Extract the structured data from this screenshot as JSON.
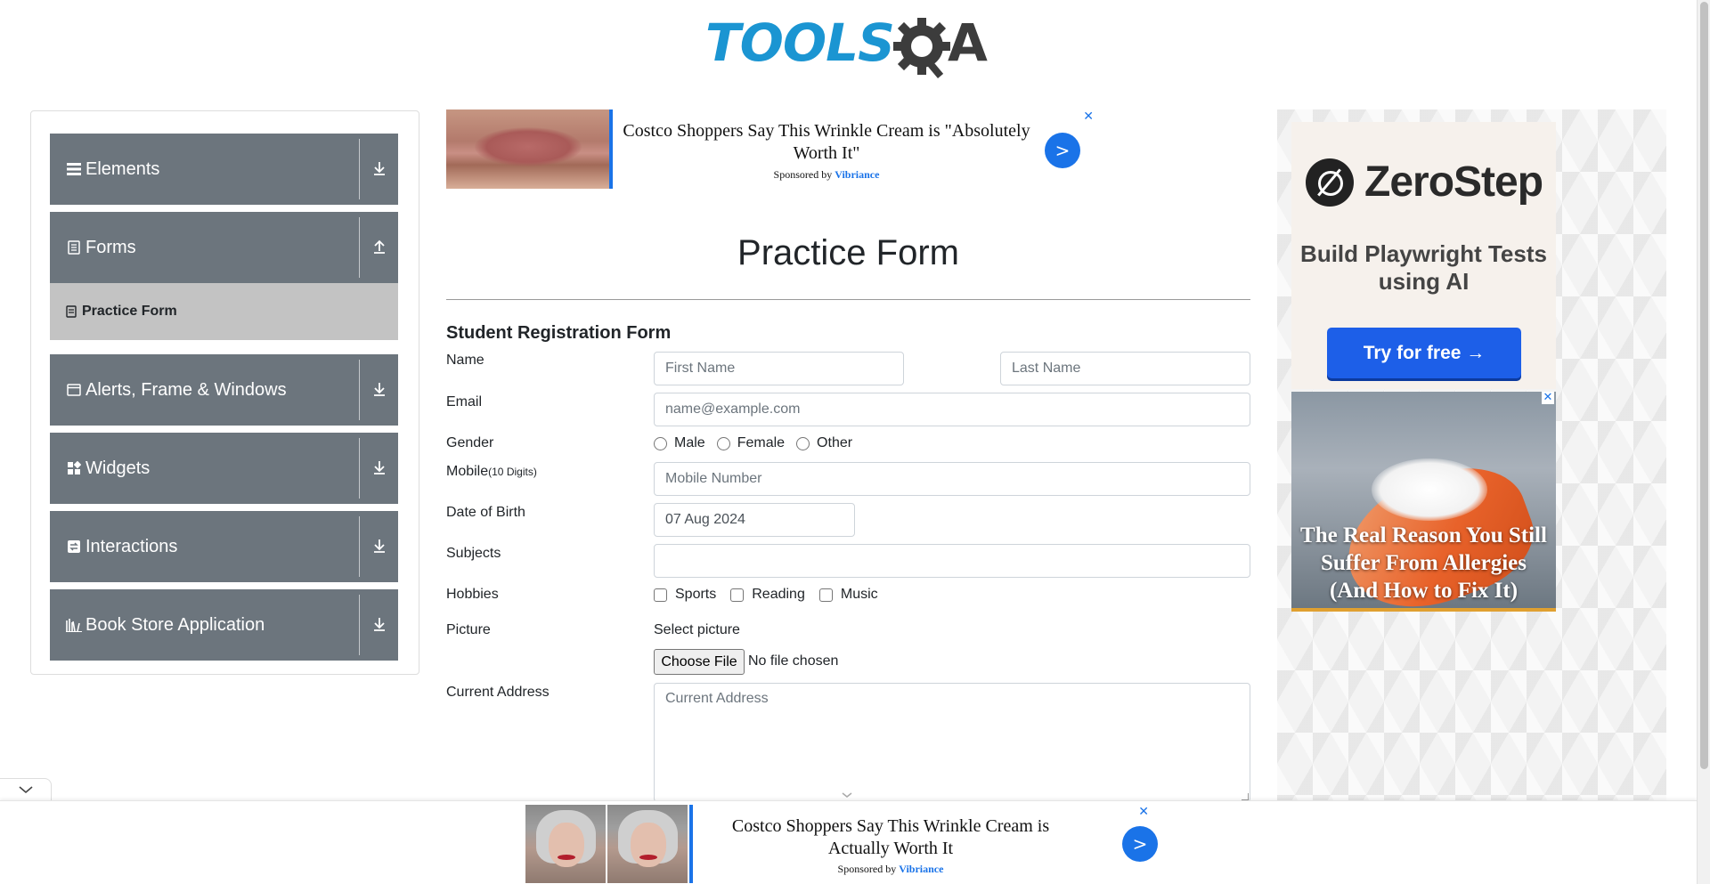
{
  "brand": {
    "logo_text": "TOOLS",
    "logo_suffix": "A"
  },
  "sidebar": {
    "groups": [
      {
        "label": "Elements",
        "icon": "menu-icon",
        "arrow": "download-arrow-icon"
      },
      {
        "label": "Forms",
        "icon": "document-icon",
        "arrow": "upload-arrow-icon"
      },
      {
        "label": "Alerts, Frame & Windows",
        "icon": "window-icon",
        "arrow": "download-arrow-icon"
      },
      {
        "label": "Widgets",
        "icon": "widgets-icon",
        "arrow": "download-arrow-icon"
      },
      {
        "label": "Interactions",
        "icon": "interactions-icon",
        "arrow": "download-arrow-icon"
      },
      {
        "label": "Book Store Application",
        "icon": "library-icon",
        "arrow": "download-arrow-icon"
      }
    ],
    "active_item": "Practice Form"
  },
  "top_ad": {
    "headline": "Costco Shoppers Say This Wrinkle Cream is \"Absolutely Worth It\"",
    "sponsored_prefix": "Sponsored by",
    "sponsor": "Vibriance",
    "go": ">",
    "close": "✕"
  },
  "form": {
    "page_title": "Practice Form",
    "form_title": "Student Registration Form",
    "name_label": "Name",
    "first_name_placeholder": "First Name",
    "last_name_placeholder": "Last Name",
    "email_label": "Email",
    "email_placeholder": "name@example.com",
    "gender_label": "Gender",
    "gender_options": [
      "Male",
      "Female",
      "Other"
    ],
    "mobile_label": "Mobile",
    "mobile_hint": "(10 Digits)",
    "mobile_placeholder": "Mobile Number",
    "dob_label": "Date of Birth",
    "dob_value": "07 Aug 2024",
    "subjects_label": "Subjects",
    "hobbies_label": "Hobbies",
    "hobby_options": [
      "Sports",
      "Reading",
      "Music"
    ],
    "picture_label": "Picture",
    "select_picture": "Select picture",
    "choose_file": "Choose File",
    "file_status": "No file chosen",
    "address_label": "Current Address",
    "address_placeholder": "Current Address"
  },
  "right_ad": {
    "brand": "ZeroStep",
    "tagline": "Build Playwright Tests using AI",
    "cta": "Try for free →",
    "second_headline": "The Real Reason You Still Suffer From Allergies (And How to Fix It)",
    "close": "✕"
  },
  "bottom_ad": {
    "headline": "Costco Shoppers Say This Wrinkle Cream is Actually Worth It",
    "sponsored_prefix": "Sponsored by",
    "sponsor": "Vibriance",
    "go": ">",
    "close": "✕"
  },
  "colors": {
    "sidebar_group_bg": "#6c757d",
    "sidebar_active_bg": "#c3c3c3",
    "brand_blue": "#1b95d2",
    "ad_accent": "#1a73e8",
    "cta_blue": "#1d5fe8"
  }
}
